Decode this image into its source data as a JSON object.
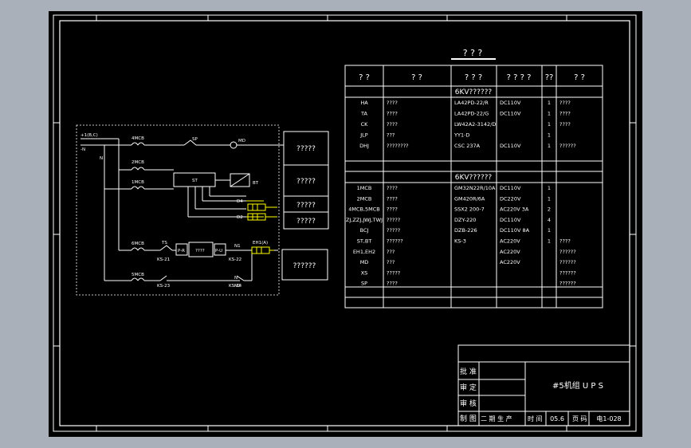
{
  "title": "? ? ?",
  "table": {
    "headers": [
      "? ?",
      "? ?",
      "? ? ?",
      "? ? ? ?",
      "??",
      "? ?"
    ],
    "section1": "6KV??????",
    "rows1": [
      [
        "HA",
        "????",
        "LA42PD-22/R",
        "DC110V",
        "1",
        "????"
      ],
      [
        "TA",
        "????",
        "LA42PD-22/G",
        "DC110V",
        "1",
        "????"
      ],
      [
        "CK",
        "????",
        "LW42A2-3142/D",
        "",
        "1",
        "????"
      ],
      [
        "JLP",
        "???",
        "YY1-D",
        "",
        "1",
        ""
      ],
      [
        "DHJ",
        "????????",
        "CSC 237A",
        "DC110V",
        "1",
        "??????"
      ]
    ],
    "section2": "6KV??????",
    "rows2": [
      [
        "1MCB",
        "????",
        "GM32N22R/10A",
        "DC110V",
        "1",
        ""
      ],
      [
        "2MCB",
        "????",
        "GM420R/6A",
        "DC220V",
        "1",
        ""
      ],
      [
        "4MCB,5MCB",
        "????",
        "SSX2 200-7",
        "AC220V 3A",
        "2",
        ""
      ],
      [
        "ZJ,ZZJ,JWJ,TWJ",
        "?????",
        "DZY-220",
        "DC110V",
        "4",
        ""
      ],
      [
        "BCJ",
        "?????",
        "DZB-226",
        "DC110V 8A",
        "1",
        ""
      ],
      [
        "ST,BT",
        "??????",
        "KS-3",
        "AC220V",
        "1",
        "????"
      ],
      [
        "EH1,EH2",
        "???",
        "",
        "AC220V",
        "",
        "??????"
      ],
      [
        "MD",
        "???",
        "",
        "AC220V",
        "",
        "??????"
      ],
      [
        "XS",
        "?????",
        "",
        "",
        "",
        "??????"
      ],
      [
        "SP",
        "????",
        "",
        "",
        "",
        "??????"
      ]
    ]
  },
  "title_block": {
    "project": "#5机组 U P S",
    "approve": "批 准",
    "review": "审 定",
    "check": "审 核",
    "draw": "制 图",
    "draw_value": "二 期 生 产",
    "date_label": "时 间",
    "date_value": "05.6",
    "page_label": "页 码",
    "page_value": "电1-028"
  },
  "schematic": {
    "labels": {
      "bus_pos": "+1(B,C)",
      "bus_neg": "-N",
      "n1": "N",
      "n2": "N",
      "c_4mcb": "4MCB",
      "c_sp": "SP",
      "c_md": "MD",
      "c_2mcb": "2MCB",
      "c_1mcb": "1MCB",
      "c_st": "ST",
      "c_bt": "BT",
      "d_d4": "D4",
      "d_d2": "D2",
      "c_6mcb": "6MCB",
      "c_5mcb": "5MCB",
      "c_ts": "TS",
      "c_wire1": "EH1(A)",
      "j_pr": "P-R",
      "j_pu": "P-U",
      "j_mid": "????",
      "t1": "N1",
      "t2": "N2",
      "t3": "KS-21",
      "t4": "KS-22",
      "t5": "KS-23",
      "t6": "KS-24"
    },
    "boxes": [
      "?????",
      "?????",
      "?????",
      "?????",
      "??????"
    ]
  },
  "colors": {
    "background": "#000000",
    "frame": "#ffffff",
    "wire": "#ffff00",
    "bg_outer": "#a9b0ba"
  }
}
